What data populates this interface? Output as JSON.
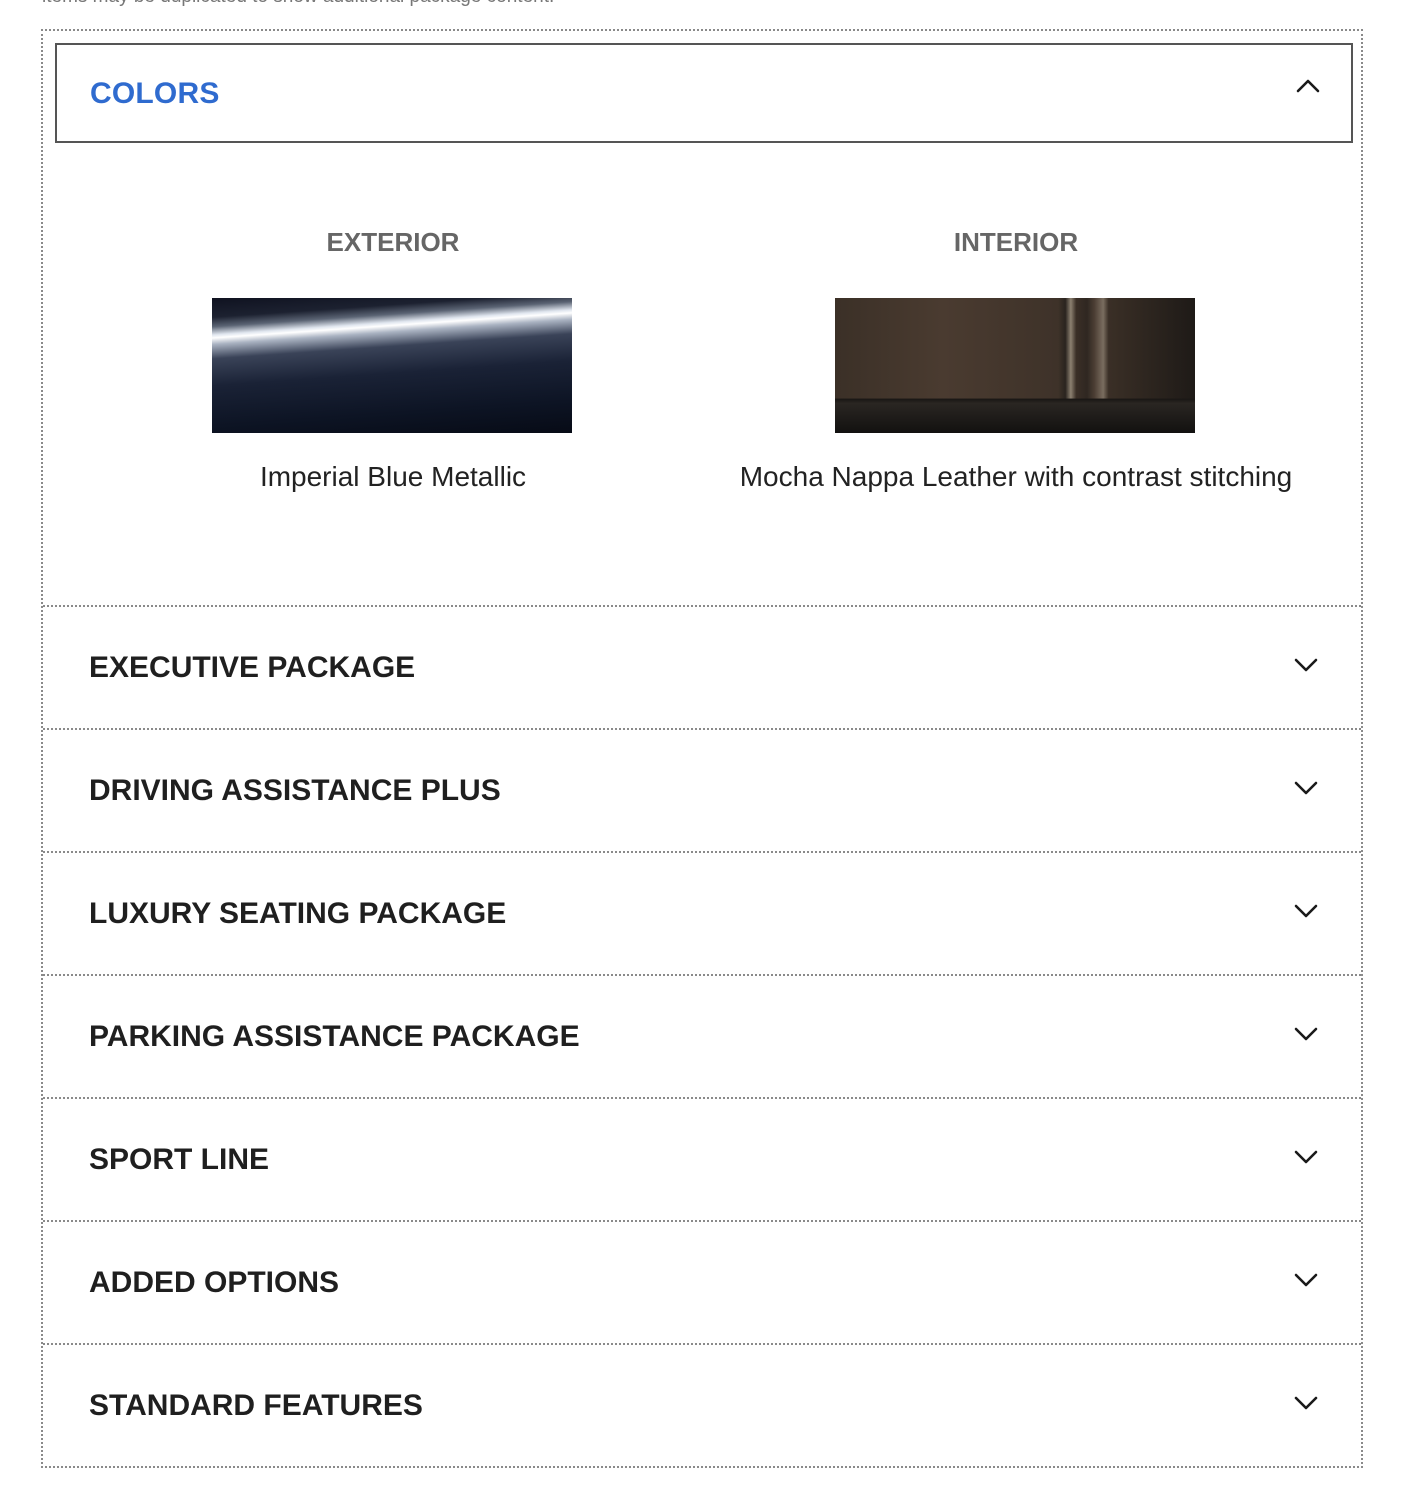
{
  "note": "items may be duplicated to show additional package content.",
  "colors": {
    "title": "COLORS",
    "exterior": {
      "heading": "EXTERIOR",
      "name": "Imperial Blue Metallic"
    },
    "interior": {
      "heading": "INTERIOR",
      "name": "Mocha Nappa Leather with contrast stitching"
    }
  },
  "sections": [
    {
      "title": "EXECUTIVE PACKAGE"
    },
    {
      "title": "DRIVING ASSISTANCE PLUS"
    },
    {
      "title": "LUXURY SEATING PACKAGE"
    },
    {
      "title": "PARKING ASSISTANCE PACKAGE"
    },
    {
      "title": "SPORT LINE"
    },
    {
      "title": "ADDED OPTIONS"
    },
    {
      "title": "STANDARD FEATURES"
    }
  ],
  "icons": {
    "expanded": "chevron-up-icon",
    "collapsed": "chevron-down-icon"
  },
  "accent_color": "#2f6bcf"
}
